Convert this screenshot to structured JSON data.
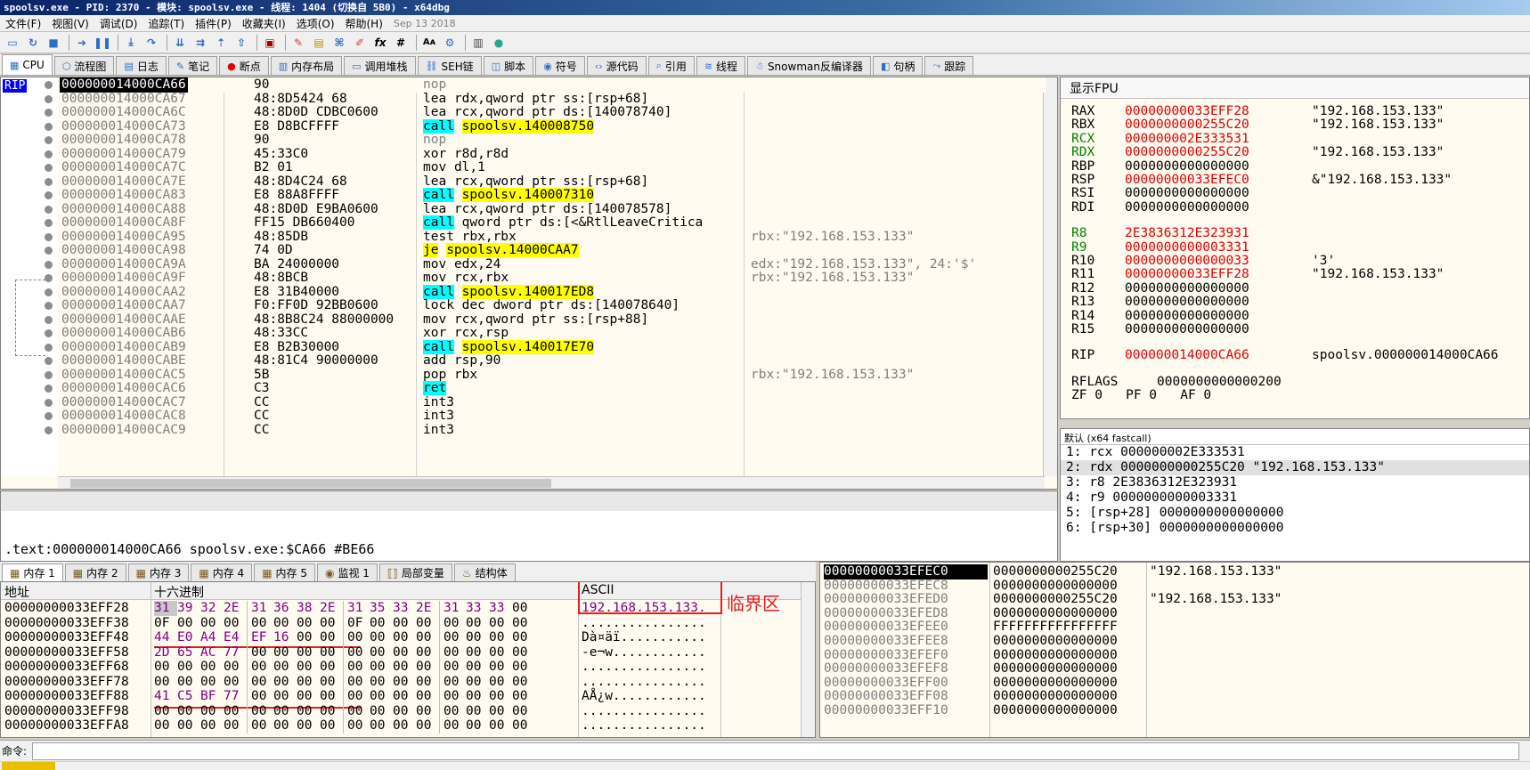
{
  "window": {
    "title": "spoolsv.exe - PID: 2370 - 模块: spoolsv.exe - 线程: 1404 (切换自 5B0) - x64dbg"
  },
  "menu": [
    "文件(F)",
    "视图(V)",
    "调试(D)",
    "追踪(T)",
    "插件(P)",
    "收藏夹(I)",
    "选项(O)",
    "帮助(H)"
  ],
  "menu_date": "Sep 13 2018",
  "tabs": [
    {
      "label": "CPU",
      "icon": "cpu-icon"
    },
    {
      "label": "流程图",
      "icon": "graph-icon"
    },
    {
      "label": "日志",
      "icon": "log-icon"
    },
    {
      "label": "笔记",
      "icon": "notes-icon"
    },
    {
      "label": "断点",
      "icon": "breakpoint-icon"
    },
    {
      "label": "内存布局",
      "icon": "memory-map-icon"
    },
    {
      "label": "调用堆栈",
      "icon": "callstack-icon"
    },
    {
      "label": "SEH链",
      "icon": "seh-icon"
    },
    {
      "label": "脚本",
      "icon": "script-icon"
    },
    {
      "label": "符号",
      "icon": "symbols-icon"
    },
    {
      "label": "源代码",
      "icon": "source-icon"
    },
    {
      "label": "引用",
      "icon": "references-icon"
    },
    {
      "label": "线程",
      "icon": "threads-icon"
    },
    {
      "label": "Snowman反编译器",
      "icon": "snowman-icon"
    },
    {
      "label": "句柄",
      "icon": "handles-icon"
    },
    {
      "label": "跟踪",
      "icon": "trace-icon"
    }
  ],
  "rip_label": "RIP",
  "disasm": [
    {
      "addr": "000000014000CA66",
      "bytes": "90",
      "mn": "nop",
      "op": "",
      "cmt": "",
      "kind": "nop",
      "sel": true
    },
    {
      "addr": "000000014000CA67",
      "bytes": "48:8D5424 68",
      "mn": "lea",
      "op": "rdx,qword ptr ss:[rsp+68]",
      "cmt": "",
      "kind": "normal"
    },
    {
      "addr": "000000014000CA6C",
      "bytes": "48:8D0D CDBC0600",
      "mn": "lea",
      "op": "rcx,qword ptr ds:[140078740]",
      "cmt": "",
      "kind": "normal"
    },
    {
      "addr": "000000014000CA73",
      "bytes": "E8 D8BCFFFF",
      "mn": "call",
      "op": "spoolsv.140008750",
      "cmt": "",
      "kind": "call"
    },
    {
      "addr": "000000014000CA78",
      "bytes": "90",
      "mn": "nop",
      "op": "",
      "cmt": "",
      "kind": "nop"
    },
    {
      "addr": "000000014000CA79",
      "bytes": "45:33C0",
      "mn": "xor",
      "op": "r8d,r8d",
      "cmt": "",
      "kind": "normal"
    },
    {
      "addr": "000000014000CA7C",
      "bytes": "B2 01",
      "mn": "mov",
      "op": "dl,1",
      "cmt": "",
      "kind": "normal"
    },
    {
      "addr": "000000014000CA7E",
      "bytes": "48:8D4C24 68",
      "mn": "lea",
      "op": "rcx,qword ptr ss:[rsp+68]",
      "cmt": "",
      "kind": "normal"
    },
    {
      "addr": "000000014000CA83",
      "bytes": "E8 88A8FFFF",
      "mn": "call",
      "op": "spoolsv.140007310",
      "cmt": "",
      "kind": "call"
    },
    {
      "addr": "000000014000CA88",
      "bytes": "48:8D0D E9BA0600",
      "mn": "lea",
      "op": "rcx,qword ptr ds:[140078578]",
      "cmt": "",
      "kind": "normal"
    },
    {
      "addr": "000000014000CA8F",
      "bytes": "FF15 DB660400",
      "mn": "call",
      "op": "qword ptr ds:[<&RtlLeaveCritica",
      "cmt": "",
      "kind": "callind"
    },
    {
      "addr": "000000014000CA95",
      "bytes": "48:85DB",
      "mn": "test",
      "op": "rbx,rbx",
      "cmt": "rbx:\"192.168.153.133\"",
      "kind": "normal"
    },
    {
      "addr": "000000014000CA98",
      "bytes": "74 0D",
      "mn": "je",
      "op": "spoolsv.14000CAA7",
      "cmt": "",
      "kind": "je"
    },
    {
      "addr": "000000014000CA9A",
      "bytes": "BA 24000000",
      "mn": "mov",
      "op": "edx,24",
      "cmt": "edx:\"192.168.153.133\", 24:'$'",
      "kind": "normal"
    },
    {
      "addr": "000000014000CA9F",
      "bytes": "48:8BCB",
      "mn": "mov",
      "op": "rcx,rbx",
      "cmt": "rbx:\"192.168.153.133\"",
      "kind": "normal"
    },
    {
      "addr": "000000014000CAA2",
      "bytes": "E8 31B40000",
      "mn": "call",
      "op": "spoolsv.140017ED8",
      "cmt": "",
      "kind": "call"
    },
    {
      "addr": "000000014000CAA7",
      "bytes": "F0:FF0D 92BB0600",
      "mn": "lock dec",
      "op": "dword ptr ds:[140078640]",
      "cmt": "",
      "kind": "normal"
    },
    {
      "addr": "000000014000CAAE",
      "bytes": "48:8B8C24 88000000",
      "mn": "mov",
      "op": "rcx,qword ptr ss:[rsp+88]",
      "cmt": "",
      "kind": "normal"
    },
    {
      "addr": "000000014000CAB6",
      "bytes": "48:33CC",
      "mn": "xor",
      "op": "rcx,rsp",
      "cmt": "",
      "kind": "normal"
    },
    {
      "addr": "000000014000CAB9",
      "bytes": "E8 B2B30000",
      "mn": "call",
      "op": "spoolsv.140017E70",
      "cmt": "",
      "kind": "call"
    },
    {
      "addr": "000000014000CABE",
      "bytes": "48:81C4 90000000",
      "mn": "add",
      "op": "rsp,90",
      "cmt": "",
      "kind": "normal"
    },
    {
      "addr": "000000014000CAC5",
      "bytes": "5B",
      "mn": "pop",
      "op": "rbx",
      "cmt": "rbx:\"192.168.153.133\"",
      "kind": "normal"
    },
    {
      "addr": "000000014000CAC6",
      "bytes": "C3",
      "mn": "ret",
      "op": "",
      "cmt": "",
      "kind": "ret"
    },
    {
      "addr": "000000014000CAC7",
      "bytes": "CC",
      "mn": "int3",
      "op": "",
      "cmt": "",
      "kind": "normal"
    },
    {
      "addr": "000000014000CAC8",
      "bytes": "CC",
      "mn": "int3",
      "op": "",
      "cmt": "",
      "kind": "normal"
    },
    {
      "addr": "000000014000CAC9",
      "bytes": "CC",
      "mn": "int3",
      "op": "",
      "cmt": "",
      "kind": "normal"
    }
  ],
  "info_text": ".text:000000014000CA66 spoolsv.exe:$CA66 #BE66",
  "regs_header": "显示FPU",
  "registers": [
    {
      "n": "RAX",
      "v": "00000000033EFF28",
      "c": "\"192.168.153.133\"",
      "color": "red"
    },
    {
      "n": "RBX",
      "v": "0000000000255C20",
      "c": "\"192.168.153.133\"",
      "color": "red"
    },
    {
      "n": "RCX",
      "v": "000000002E333531",
      "c": "",
      "color": "red",
      "ncolor": "green"
    },
    {
      "n": "RDX",
      "v": "0000000000255C20",
      "c": "\"192.168.153.133\"",
      "color": "red",
      "ncolor": "green"
    },
    {
      "n": "RBP",
      "v": "0000000000000000",
      "c": "",
      "color": "black"
    },
    {
      "n": "RSP",
      "v": "00000000033EFEC0",
      "c": "&\"192.168.153.133\"",
      "color": "red"
    },
    {
      "n": "RSI",
      "v": "0000000000000000",
      "c": "",
      "color": "black"
    },
    {
      "n": "RDI",
      "v": "0000000000000000",
      "c": "",
      "color": "black"
    },
    {
      "n": "R8",
      "v": "2E3836312E323931",
      "c": "",
      "color": "red",
      "ncolor": "green"
    },
    {
      "n": "R9",
      "v": "0000000000003331",
      "c": "",
      "color": "red",
      "ncolor": "green"
    },
    {
      "n": "R10",
      "v": "0000000000000033",
      "c": "'3'",
      "color": "red"
    },
    {
      "n": "R11",
      "v": "00000000033EFF28",
      "c": "\"192.168.153.133\"",
      "color": "red"
    },
    {
      "n": "R12",
      "v": "0000000000000000",
      "c": "",
      "color": "black"
    },
    {
      "n": "R13",
      "v": "0000000000000000",
      "c": "",
      "color": "black"
    },
    {
      "n": "R14",
      "v": "0000000000000000",
      "c": "",
      "color": "black"
    },
    {
      "n": "R15",
      "v": "0000000000000000",
      "c": "",
      "color": "black"
    },
    {
      "n": "RIP",
      "v": "000000014000CA66",
      "c": "spoolsv.000000014000CA66",
      "color": "red"
    }
  ],
  "rflags": {
    "label": "RFLAGS",
    "value": "0000000000000200",
    "flags": "ZF 0   PF 0   AF 0"
  },
  "args_header": "默认 (x64 fastcall)",
  "args": [
    "1: rcx 000000002E333531",
    "2: rdx 0000000000255C20 \"192.168.153.133\"",
    "3: r8 2E3836312E323931",
    "4: r9 0000000000003331",
    "5: [rsp+28] 0000000000000000",
    "6: [rsp+30] 0000000000000000"
  ],
  "bottom_tabs": [
    "内存 1",
    "内存 2",
    "内存 3",
    "内存 4",
    "内存 5",
    "监视 1",
    "局部变量",
    "结构体"
  ],
  "dump_headers": {
    "addr": "地址",
    "hex": "十六进制",
    "ascii": "ASCII"
  },
  "dump": [
    {
      "a": "00000000033EFF28",
      "h": [
        "31",
        "39",
        "32",
        "2E",
        "31",
        "36",
        "38",
        "2E",
        "31",
        "35",
        "33",
        "2E",
        "31",
        "33",
        "33",
        "00"
      ],
      "s": "192.168.153.133."
    },
    {
      "a": "00000000033EFF38",
      "h": [
        "0F",
        "00",
        "00",
        "00",
        "00",
        "00",
        "00",
        "00",
        "0F",
        "00",
        "00",
        "00",
        "00",
        "00",
        "00",
        "00"
      ],
      "s": "................"
    },
    {
      "a": "00000000033EFF48",
      "h": [
        "44",
        "E0",
        "A4",
        "E4",
        "EF",
        "16",
        "00",
        "00",
        "00",
        "00",
        "00",
        "00",
        "00",
        "00",
        "00",
        "00"
      ],
      "s": "Dà¤äï..........."
    },
    {
      "a": "00000000033EFF58",
      "h": [
        "2D",
        "65",
        "AC",
        "77",
        "00",
        "00",
        "00",
        "00",
        "00",
        "00",
        "00",
        "00",
        "00",
        "00",
        "00",
        "00"
      ],
      "s": "-e¬w............"
    },
    {
      "a": "00000000033EFF68",
      "h": [
        "00",
        "00",
        "00",
        "00",
        "00",
        "00",
        "00",
        "00",
        "00",
        "00",
        "00",
        "00",
        "00",
        "00",
        "00",
        "00"
      ],
      "s": "................"
    },
    {
      "a": "00000000033EFF78",
      "h": [
        "00",
        "00",
        "00",
        "00",
        "00",
        "00",
        "00",
        "00",
        "00",
        "00",
        "00",
        "00",
        "00",
        "00",
        "00",
        "00"
      ],
      "s": "................"
    },
    {
      "a": "00000000033EFF88",
      "h": [
        "41",
        "C5",
        "BF",
        "77",
        "00",
        "00",
        "00",
        "00",
        "00",
        "00",
        "00",
        "00",
        "00",
        "00",
        "00",
        "00"
      ],
      "s": "AÅ¿w............"
    },
    {
      "a": "00000000033EFF98",
      "h": [
        "00",
        "00",
        "00",
        "00",
        "00",
        "00",
        "00",
        "00",
        "00",
        "00",
        "00",
        "00",
        "00",
        "00",
        "00",
        "00"
      ],
      "s": "................"
    },
    {
      "a": "00000000033EFFA8",
      "h": [
        "00",
        "00",
        "00",
        "00",
        "00",
        "00",
        "00",
        "00",
        "00",
        "00",
        "00",
        "00",
        "00",
        "00",
        "00",
        "00"
      ],
      "s": "................"
    }
  ],
  "annotation": "临界区",
  "stack": [
    {
      "a": "00000000033EFEC0",
      "v": "0000000000255C20",
      "c": "\"192.168.153.133\"",
      "sel": true
    },
    {
      "a": "00000000033EFEC8",
      "v": "0000000000000000",
      "c": ""
    },
    {
      "a": "00000000033EFED0",
      "v": "0000000000255C20",
      "c": "\"192.168.153.133\""
    },
    {
      "a": "00000000033EFED8",
      "v": "0000000000000000",
      "c": ""
    },
    {
      "a": "00000000033EFEE0",
      "v": "FFFFFFFFFFFFFFFF",
      "c": ""
    },
    {
      "a": "00000000033EFEE8",
      "v": "0000000000000000",
      "c": ""
    },
    {
      "a": "00000000033EFEF0",
      "v": "0000000000000000",
      "c": ""
    },
    {
      "a": "00000000033EFEF8",
      "v": "0000000000000000",
      "c": ""
    },
    {
      "a": "00000000033EFF00",
      "v": "0000000000000000",
      "c": ""
    },
    {
      "a": "00000000033EFF08",
      "v": "0000000000000000",
      "c": ""
    },
    {
      "a": "00000000033EFF10",
      "v": "0000000000000000",
      "c": ""
    }
  ],
  "command_label": "命令:"
}
